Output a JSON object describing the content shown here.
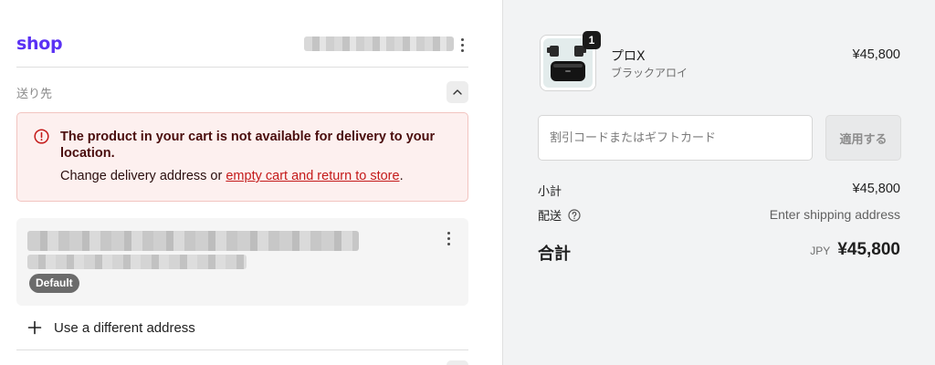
{
  "header": {
    "logo_text": "shop",
    "account_masked": true
  },
  "shipping": {
    "section_label": "送り先",
    "alert": {
      "title": "The product in your cart is not available for delivery to your location.",
      "body_prefix": "Change delivery address or ",
      "link_text": "empty cart and return to store",
      "body_suffix": "."
    },
    "address_card": {
      "badge": "Default",
      "address_masked": true
    },
    "use_different_label": "Use a different address"
  },
  "summary": {
    "product": {
      "name": "プロX",
      "variant": "ブラックアロイ",
      "price": "¥45,800",
      "quantity": "1"
    },
    "discount": {
      "placeholder": "割引コードまたはギフトカード",
      "value": "",
      "apply_label": "適用する"
    },
    "subtotal": {
      "label": "小計",
      "value": "¥45,800"
    },
    "shipping": {
      "label": "配送",
      "value": "Enter shipping address"
    },
    "total": {
      "label": "合計",
      "currency": "JPY",
      "value": "¥45,800"
    }
  },
  "colors": {
    "brand": "#5a31f4",
    "alert_bg": "#fdf0ef",
    "alert_border": "#f2c4c0",
    "link": "#c41a1a",
    "summary_bg": "#f2f3f4"
  }
}
